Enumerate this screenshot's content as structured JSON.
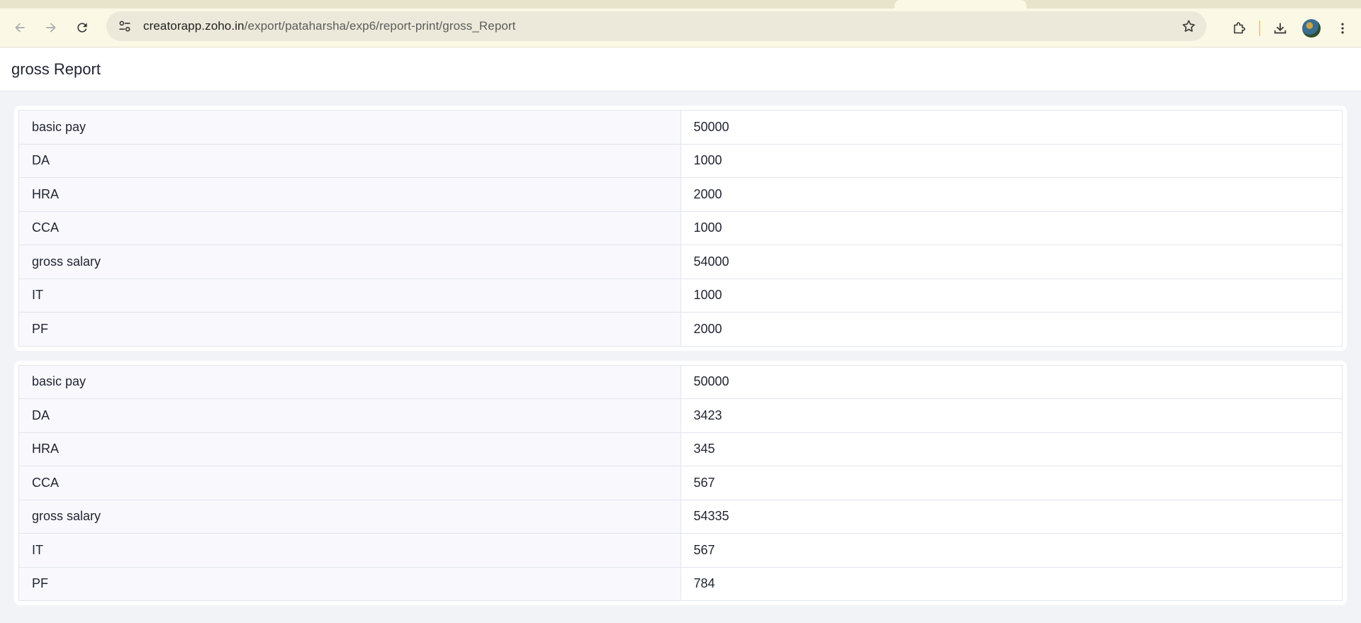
{
  "browser": {
    "url_host": "creatorapp.zoho.in",
    "url_path": "/export/pataharsha/exp6/report-print/gross_Report"
  },
  "page": {
    "title": "gross Report"
  },
  "records": [
    {
      "rows": [
        {
          "label": "basic pay",
          "value": "50000"
        },
        {
          "label": "DA",
          "value": "1000"
        },
        {
          "label": "HRA",
          "value": "2000"
        },
        {
          "label": "CCA",
          "value": "1000"
        },
        {
          "label": "gross salary",
          "value": "54000"
        },
        {
          "label": "IT",
          "value": "1000"
        },
        {
          "label": "PF",
          "value": "2000"
        }
      ]
    },
    {
      "rows": [
        {
          "label": "basic pay",
          "value": "50000"
        },
        {
          "label": "DA",
          "value": "3423"
        },
        {
          "label": "HRA",
          "value": "345"
        },
        {
          "label": "CCA",
          "value": "567"
        },
        {
          "label": "gross salary",
          "value": "54335"
        },
        {
          "label": "IT",
          "value": "567"
        },
        {
          "label": "PF",
          "value": "784"
        }
      ]
    }
  ]
}
